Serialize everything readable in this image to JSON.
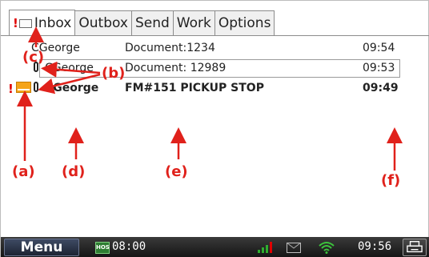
{
  "tabs": [
    {
      "label": "Inbox",
      "active": true,
      "has_alert": true
    },
    {
      "label": "Outbox"
    },
    {
      "label": "Send"
    },
    {
      "label": "Work"
    },
    {
      "label": "Options"
    }
  ],
  "alert_glyph": "!",
  "messages": [
    {
      "from": "CGeorge",
      "subject": "Document:1234",
      "time": "09:54",
      "bold": false,
      "attachment": false,
      "unread": false
    },
    {
      "from": "CGeorge",
      "subject": "Document: 12989",
      "time": "09:53",
      "bold": false,
      "attachment": true,
      "unread": false,
      "selected": true
    },
    {
      "from": "CGeorge",
      "subject": "FM#151 PICKUP STOP",
      "time": "09:49",
      "bold": true,
      "attachment": true,
      "unread": true,
      "priority": true
    }
  ],
  "annotations": {
    "a": "(a)",
    "b": "(b)",
    "c": "(c)",
    "d": "(d)",
    "e": "(e)",
    "f": "(f)"
  },
  "taskbar": {
    "menu_label": "Menu",
    "hos_badge": "HOS",
    "hos_time": "08:00",
    "clock": "09:56"
  },
  "colors": {
    "annotation": "#e0211b",
    "unread_envelope": "#f5a419",
    "taskbar": "#1a1a1a",
    "signal": "#2fae2f",
    "wifi": "#3cc43c"
  },
  "icons": [
    "alert-icon",
    "envelope-icon",
    "unread-envelope-icon",
    "paperclip-icon",
    "signal-icon",
    "mail-icon",
    "wifi-icon",
    "printer-icon"
  ]
}
